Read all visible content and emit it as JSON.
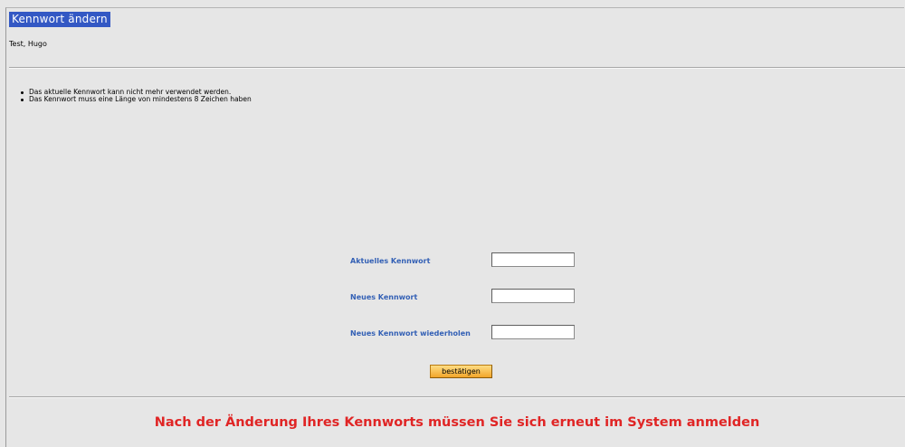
{
  "page": {
    "title": "Kennwort ändern",
    "user": "Test, Hugo"
  },
  "rules": [
    "Das aktuelle Kennwort kann nicht mehr verwendet werden.",
    "Das Kennwort muss eine Länge von mindestens 8 Zeichen haben"
  ],
  "form": {
    "current_label": "Aktuelles Kennwort",
    "current_value": "",
    "new_label": "Neues Kennwort",
    "new_value": "",
    "repeat_label": "Neues Kennwort wiederholen",
    "repeat_value": "",
    "submit_label": "bestätigen"
  },
  "notice": "Nach der Änderung Ihres Kennworts müssen Sie sich erneut im System anmelden",
  "colors": {
    "title_bg": "#3358c4",
    "label": "#3360b5",
    "notice": "#e02525",
    "button": "#f2a52a",
    "background": "#e6e6e6"
  }
}
